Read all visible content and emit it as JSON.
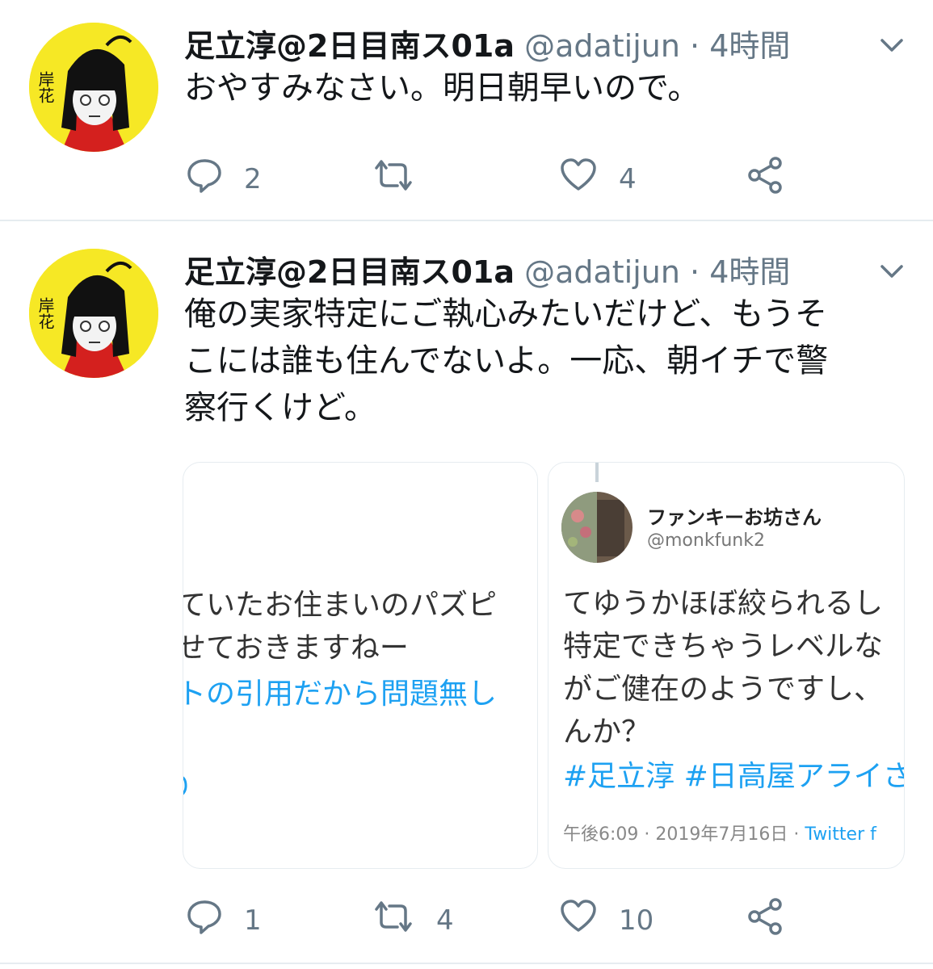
{
  "tweets": [
    {
      "name": "足立淳@2日目南ス01a",
      "handle": "@adatijun",
      "separator": "·",
      "time": "4時間",
      "text": "おやすみなさい。明日朝早いので。",
      "avatar_text": "岸花",
      "replies": "2",
      "retweets": "",
      "likes": "4"
    },
    {
      "name": "足立淳@2日目南ス01a",
      "handle": "@adatijun",
      "separator": "·",
      "time": "4時間",
      "text_lines": [
        "俺の実家特定にご執心みたいだけど、もうそ",
        "こには誰も住んでないよ。一応、朝イチで警",
        "察行くけど。"
      ],
      "avatar_text": "岸花",
      "replies": "1",
      "retweets": "4",
      "likes": "10"
    }
  ],
  "left_card": {
    "lines": [
      "ていたお住まいのパズピ",
      "せておきますねー",
      "トの引用だから問題無し",
      "り"
    ]
  },
  "quoted_tweet": {
    "name": "ファンキーお坊さん",
    "handle": "@monkfunk2",
    "lines": [
      "てゆうかほぼ絞られるし",
      "特定できちゃうレベルな",
      "がご健在のようですし、",
      "んか？"
    ],
    "hashtags": "#足立淳 #日高屋アライさん",
    "time": "午後6:09",
    "separator": "·",
    "date": "2019年7月16日",
    "source": "Twitter f"
  },
  "colors": {
    "accent": "#1da1f2",
    "muted": "#657786",
    "avatar_bg": "#f6e825",
    "divider": "#e6ecf0"
  },
  "icons": [
    "reply-icon",
    "retweet-icon",
    "like-icon",
    "share-icon",
    "chevron-down-icon"
  ]
}
